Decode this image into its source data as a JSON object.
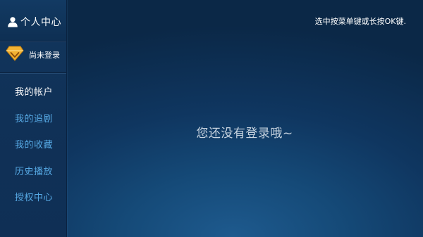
{
  "sidebar": {
    "title": "个人中心",
    "title_icon": "user-icon",
    "login_icon": "vip-diamond-icon",
    "login_status": "尚未登录",
    "items": [
      {
        "label": "我的帐户",
        "active": true
      },
      {
        "label": "我的追剧",
        "active": false
      },
      {
        "label": "我的收藏",
        "active": false
      },
      {
        "label": "历史播放",
        "active": false
      },
      {
        "label": "授权中心",
        "active": false
      }
    ]
  },
  "hint": "选中按菜单键或长按OK键.",
  "main": {
    "message": "您还没有登录哦~"
  },
  "colors": {
    "accent_text": "#56a8e3",
    "active_text": "#ffffff",
    "badge_gold": "#f2b233",
    "background": "#154a78"
  }
}
